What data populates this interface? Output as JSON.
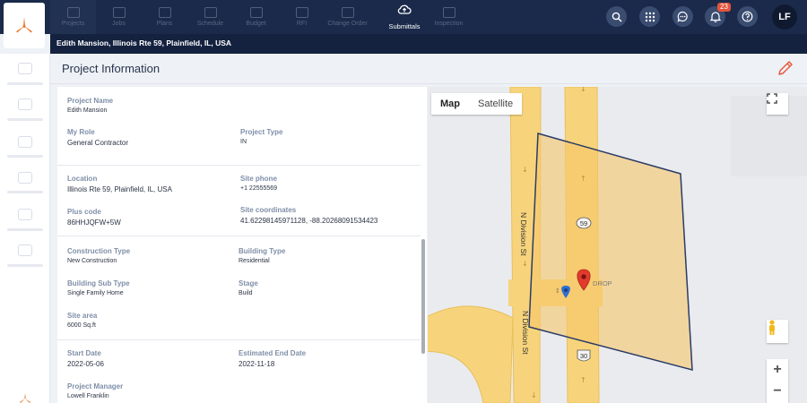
{
  "nav": {
    "tabs": [
      {
        "label": "Projects"
      },
      {
        "label": "Jobs"
      },
      {
        "label": "Plans"
      },
      {
        "label": "Schedule"
      },
      {
        "label": "Budget"
      },
      {
        "label": "RFI"
      },
      {
        "label": "Change Order"
      }
    ],
    "active_tab": {
      "label": "Submittals"
    },
    "after_tabs": [
      {
        "label": "Inspection"
      }
    ],
    "notification_count": "23",
    "user_initials": "LF"
  },
  "breadcrumb": "Edith Mansion, Illinois Rte 59, Plainfield, IL, USA",
  "page_title": "Project Information",
  "project": {
    "project_name_label": "Project Name",
    "project_name": "Edith Mansion",
    "my_role_label": "My Role",
    "my_role": "General Contractor",
    "project_type_label": "Project Type",
    "project_type": "IN",
    "location_label": "Location",
    "location": "Illinois Rte 59, Plainfield, IL, USA",
    "site_phone_label": "Site phone",
    "site_phone": "+1 22555569",
    "plus_code_label": "Plus code",
    "plus_code": "86HHJQFW+5W",
    "site_coordinates_label": "Site coordinates",
    "site_coordinates": "41.62298145971128, -88.20268091534423",
    "construction_type_label": "Construction Type",
    "construction_type": "New Construction",
    "building_type_label": "Building Type",
    "building_type": "Residential",
    "building_sub_type_label": "Building Sub Type",
    "building_sub_type": "Single Family Home",
    "stage_label": "Stage",
    "stage": "Build",
    "site_area_label": "Site area",
    "site_area": "6000 Sq.ft",
    "start_date_label": "Start Date",
    "start_date": "2022-05-06",
    "end_date_label": "Estimated End Date",
    "end_date": "2022-11-18",
    "manager_label": "Project Manager",
    "manager": "Lowell Franklin"
  },
  "map": {
    "type_map": "Map",
    "type_satellite": "Satellite",
    "street_1": "N Division St",
    "street_2": "N Division St",
    "route_59": "59",
    "route_30": "30",
    "marker_label": "DROP",
    "zoom_in": "+",
    "zoom_out": "−",
    "road_color": "#f7d47c",
    "polygon_fill": "#f6c66a",
    "polygon_stroke": "#2b3b66",
    "marker_color": "#e23a2d"
  },
  "colors": {
    "navbar": "#1b2a4a",
    "breadcrumb_bar": "#14223f",
    "accent_edit": "#e85a3a"
  }
}
